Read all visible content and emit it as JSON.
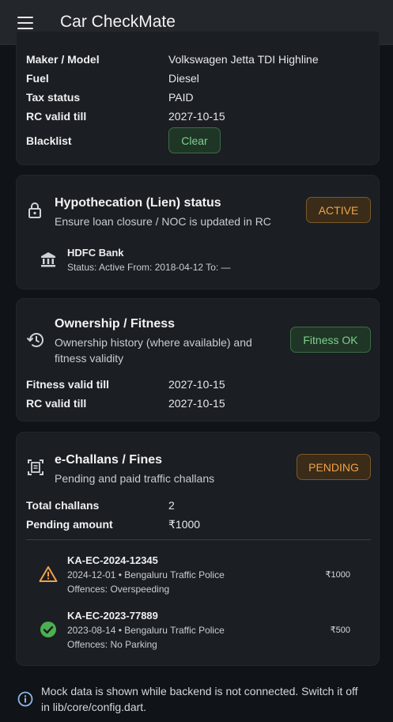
{
  "appbar": {
    "title": "Car CheckMate"
  },
  "vehicle": {
    "rows": [
      {
        "label": "Maker / Model",
        "value": "Volkswagen Jetta TDI Highline"
      },
      {
        "label": "Fuel",
        "value": "Diesel"
      },
      {
        "label": "Tax status",
        "value": "PAID"
      },
      {
        "label": "RC valid till",
        "value": "2027-10-15"
      }
    ],
    "blacklist_label": "Blacklist",
    "blacklist_chip": "Clear"
  },
  "hypothecation": {
    "title": "Hypothecation (Lien) status",
    "subtitle": "Ensure loan closure / NOC is updated in RC",
    "chip": "ACTIVE",
    "lender": "HDFC Bank",
    "details": "Status: Active  From: 2018-04-12  To: —"
  },
  "ownership": {
    "title": "Ownership / Fitness",
    "subtitle_line1": "Ownership history (where available) and",
    "subtitle_line2": "fitness validity",
    "chip": "Fitness OK",
    "rows": [
      {
        "label": "Fitness valid till",
        "value": "2027-10-15"
      },
      {
        "label": "RC valid till",
        "value": "2027-10-15"
      }
    ]
  },
  "challans": {
    "title": "e-Challans / Fines",
    "subtitle": "Pending and paid traffic challans",
    "chip": "PENDING",
    "rows": [
      {
        "label": "Total challans",
        "value": "2"
      },
      {
        "label": "Pending amount",
        "value": "₹1000"
      }
    ],
    "items": [
      {
        "id": "KA-EC-2024-12345",
        "line1": "2024-12-01 • Bengaluru Traffic Police",
        "line2": "Offences: Overspeeding",
        "amount": "₹1000",
        "status_icon": "warning-icon",
        "status_color": "#f0a24a"
      },
      {
        "id": "KA-EC-2023-77889",
        "line1": "2023-08-14 • Bengaluru Traffic Police",
        "line2": "Offences: No Parking",
        "amount": "₹500",
        "status_icon": "check-circle-icon",
        "status_color": "#4caf50"
      }
    ]
  },
  "footer": {
    "line1": "Mock data is shown while backend is not connected. Switch it off",
    "line2": "in lib/core/config.dart."
  }
}
